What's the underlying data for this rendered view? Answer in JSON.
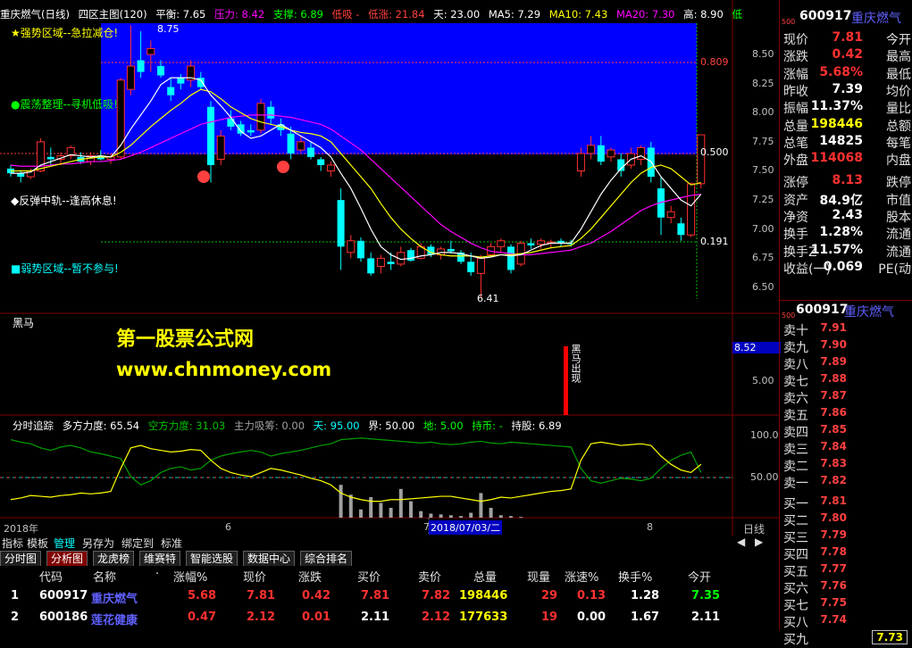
{
  "colors": {
    "up": "#ff3030",
    "down": "#00ffff",
    "yellow": "#ffff00",
    "blue_zone": "#0000ff",
    "magenta": "#ff00ff",
    "white": "#ffffff",
    "green": "#00c000",
    "grey": "#c0c0c0"
  },
  "main_header": {
    "title": "重庆燃气(日线)",
    "zone": "四区主图(120)",
    "pingheng": "平衡: 7.65",
    "yali": "压力: 8.42",
    "zhicheng": "支撑: 6.89",
    "dixi": "低吸 -",
    "dizhang": "低涨: 21.84",
    "tian": "天: 23.00",
    "ma5": "MA5: 7.29",
    "ma10": "MA10: 7.43",
    "ma20": "MA20: 7.30",
    "gao": "高: 8.90",
    "di": "低"
  },
  "zones": {
    "z1": "★强势区域--急拉减仓!",
    "z2": "●震荡整理--寻机低吸!",
    "z3": "◆反弹中轨--逢高休息!",
    "z4": "■弱势区域--暂不参与!"
  },
  "price_annots": {
    "high": "8.75",
    "low": "6.41",
    "r1": "0.809",
    "r2": "0.500",
    "r3": "0.191"
  },
  "price_axis": [
    "8.50",
    "8.25",
    "8.00",
    "7.75",
    "7.50",
    "7.25",
    "7.00",
    "6.75",
    "6.50"
  ],
  "heima": {
    "title": "黑马",
    "label": "黑马出现",
    "axis_val": "8.52",
    "axis2": "5.00"
  },
  "watermark": {
    "line1": "第一股票公式网",
    "line2": "www.chnmoney.com"
  },
  "osc": {
    "title": "分时追踪",
    "duofang": "多方力度: 65.54",
    "kongfang": "空方力度: 31.03",
    "zhuli": "主力吸筹: 0.00",
    "tian": "天: 95.00",
    "jie": "界: 50.00",
    "di": "地: 5.00",
    "chibi": "持币: -",
    "chigu": "持股: 6.89",
    "axis": [
      "100.0",
      "50.00"
    ]
  },
  "date_axis": {
    "d1": "2018年",
    "d2": "6",
    "d3": "7",
    "d4": "8",
    "cursor": "2018/07/03/二",
    "period": "日线"
  },
  "toolbar": [
    "指标",
    "模板",
    "管理",
    "另存为",
    "绑定到",
    "标准"
  ],
  "tabs": [
    "分时图",
    "分析图",
    "龙虎榜",
    "维赛特",
    "智能选股",
    "数据中心",
    "综合排名"
  ],
  "table": {
    "headers": [
      "代码",
      "名称",
      "·",
      "涨幅%",
      "现价",
      "涨跌",
      "买价",
      "卖价",
      "总量",
      "现量",
      "涨速%",
      "换手%",
      "今开"
    ],
    "rows": [
      {
        "idx": "1",
        "code": "600917",
        "name": "重庆燃气",
        "chg_pct": "5.68",
        "price": "7.81",
        "chg": "0.42",
        "bid": "7.81",
        "ask": "7.82",
        "vol": "198446",
        "cur": "29",
        "speed": "0.13",
        "turn": "1.28",
        "open": "7.35"
      },
      {
        "idx": "2",
        "code": "600186",
        "name": "莲花健康",
        "chg_pct": "0.47",
        "price": "2.12",
        "chg": "0.01",
        "bid": "2.11",
        "ask": "2.12",
        "vol": "177633",
        "cur": "19",
        "speed": "0.00",
        "turn": "1.67",
        "open": "2.11"
      }
    ]
  },
  "quote": {
    "code": "600917",
    "name": "重庆燃气",
    "tag": "500",
    "rows": [
      {
        "l": "现价",
        "v": "7.81",
        "r": "今开",
        "c": "up"
      },
      {
        "l": "涨跌",
        "v": "0.42",
        "r": "最高",
        "c": "up"
      },
      {
        "l": "涨幅",
        "v": "5.68%",
        "r": "最低",
        "c": "up"
      },
      {
        "l": "昨收",
        "v": "7.39",
        "r": "均价",
        "c": "white"
      },
      {
        "l": "振幅",
        "v": "11.37%",
        "r": "量比",
        "c": "white"
      },
      {
        "l": "总量",
        "v": "198446",
        "r": "总额",
        "c": "yellow"
      },
      {
        "l": "总笔",
        "v": "14825",
        "r": "每笔",
        "c": "white"
      },
      {
        "l": "外盘",
        "v": "114068",
        "r": "内盘",
        "c": "up"
      },
      {
        "l": "涨停",
        "v": "8.13",
        "r": "跌停",
        "c": "up"
      },
      {
        "l": "资产",
        "v": "84.9亿",
        "r": "市值",
        "c": "white"
      },
      {
        "l": "净资",
        "v": "2.43",
        "r": "股本",
        "c": "white"
      },
      {
        "l": "换手",
        "v": "1.28%",
        "r": "流通",
        "c": "white"
      },
      {
        "l": "换手Z",
        "v": "11.57%",
        "r": "流通",
        "c": "white"
      },
      {
        "l": "收益(一)",
        "v": "0.069",
        "r": "PE(动",
        "c": "white"
      }
    ]
  },
  "orderbook": {
    "code": "600917",
    "name": "重庆燃气",
    "tag": "500",
    "sells": [
      {
        "l": "卖十",
        "v": "7.91"
      },
      {
        "l": "卖九",
        "v": "7.90"
      },
      {
        "l": "卖八",
        "v": "7.89"
      },
      {
        "l": "卖七",
        "v": "7.88"
      },
      {
        "l": "卖六",
        "v": "7.87"
      },
      {
        "l": "卖五",
        "v": "7.86"
      },
      {
        "l": "卖四",
        "v": "7.85"
      },
      {
        "l": "卖三",
        "v": "7.84"
      },
      {
        "l": "卖二",
        "v": "7.83"
      },
      {
        "l": "卖一",
        "v": "7.82"
      }
    ],
    "buys": [
      {
        "l": "买一",
        "v": "7.81"
      },
      {
        "l": "买二",
        "v": "7.80"
      },
      {
        "l": "买三",
        "v": "7.79"
      },
      {
        "l": "买四",
        "v": "7.78"
      },
      {
        "l": "买五",
        "v": "7.77"
      },
      {
        "l": "买六",
        "v": "7.76"
      },
      {
        "l": "买七",
        "v": "7.75"
      },
      {
        "l": "买八",
        "v": "7.74"
      },
      {
        "l": "买九",
        "v": "7.73"
      }
    ]
  },
  "chart_data": {
    "type": "candlestick",
    "candles": [
      [
        7.52,
        7.55,
        7.45,
        7.48
      ],
      [
        7.48,
        7.5,
        7.4,
        7.45
      ],
      [
        7.45,
        7.52,
        7.43,
        7.5
      ],
      [
        7.5,
        7.78,
        7.49,
        7.75
      ],
      [
        7.62,
        7.7,
        7.55,
        7.6
      ],
      [
        7.6,
        7.66,
        7.55,
        7.63
      ],
      [
        7.63,
        7.72,
        7.6,
        7.7
      ],
      [
        7.62,
        7.66,
        7.56,
        7.58
      ],
      [
        7.58,
        7.66,
        7.55,
        7.63
      ],
      [
        7.63,
        7.68,
        7.59,
        7.6
      ],
      [
        7.6,
        7.65,
        7.56,
        7.62
      ],
      [
        7.62,
        8.3,
        7.6,
        8.28
      ],
      [
        8.2,
        8.75,
        8.15,
        8.4
      ],
      [
        8.45,
        8.7,
        8.3,
        8.35
      ],
      [
        8.5,
        8.62,
        8.35,
        8.55
      ],
      [
        8.4,
        8.45,
        8.3,
        8.32
      ],
      [
        8.22,
        8.3,
        8.1,
        8.15
      ],
      [
        8.3,
        8.33,
        8.2,
        8.25
      ],
      [
        8.28,
        8.45,
        8.22,
        8.4
      ],
      [
        8.3,
        8.35,
        8.2,
        8.22
      ],
      [
        8.05,
        8.1,
        7.4,
        7.55
      ],
      [
        7.6,
        7.85,
        7.55,
        7.8
      ],
      [
        7.95,
        8.02,
        7.85,
        7.88
      ],
      [
        7.9,
        7.93,
        7.8,
        7.82
      ],
      [
        7.85,
        7.9,
        7.8,
        7.83
      ],
      [
        7.85,
        8.12,
        7.82,
        8.08
      ],
      [
        8.05,
        8.1,
        7.9,
        7.95
      ],
      [
        7.9,
        7.95,
        7.8,
        7.85
      ],
      [
        7.82,
        7.88,
        7.6,
        7.65
      ],
      [
        7.68,
        7.8,
        7.66,
        7.75
      ],
      [
        7.7,
        7.75,
        7.6,
        7.62
      ],
      [
        7.6,
        7.62,
        7.5,
        7.55
      ],
      [
        7.5,
        7.58,
        7.45,
        7.55
      ],
      [
        7.25,
        7.35,
        6.65,
        6.85
      ],
      [
        6.8,
        6.95,
        6.75,
        6.9
      ],
      [
        6.9,
        6.93,
        6.72,
        6.75
      ],
      [
        6.75,
        6.8,
        6.6,
        6.62
      ],
      [
        6.68,
        6.78,
        6.62,
        6.75
      ],
      [
        6.72,
        6.8,
        6.65,
        6.7
      ],
      [
        6.7,
        6.85,
        6.68,
        6.8
      ],
      [
        6.82,
        6.84,
        6.72,
        6.73
      ],
      [
        6.75,
        6.88,
        6.74,
        6.85
      ],
      [
        6.85,
        6.87,
        6.76,
        6.78
      ],
      [
        6.78,
        6.85,
        6.74,
        6.83
      ],
      [
        6.83,
        6.9,
        6.79,
        6.81
      ],
      [
        6.8,
        6.82,
        6.7,
        6.72
      ],
      [
        6.72,
        6.8,
        6.6,
        6.63
      ],
      [
        6.62,
        6.78,
        6.41,
        6.75
      ],
      [
        6.78,
        6.88,
        6.76,
        6.85
      ],
      [
        6.85,
        6.92,
        6.8,
        6.9
      ],
      [
        6.85,
        6.87,
        6.62,
        6.65
      ],
      [
        6.7,
        6.9,
        6.68,
        6.88
      ],
      [
        6.88,
        6.92,
        6.83,
        6.86
      ],
      [
        6.87,
        6.92,
        6.83,
        6.9
      ],
      [
        6.88,
        6.91,
        6.84,
        6.89
      ],
      [
        6.9,
        6.92,
        6.85,
        6.88
      ],
      [
        6.88,
        6.91,
        6.85,
        6.87
      ],
      [
        7.5,
        7.7,
        7.45,
        7.65
      ],
      [
        7.65,
        7.8,
        7.6,
        7.72
      ],
      [
        7.72,
        7.8,
        7.55,
        7.58
      ],
      [
        7.62,
        7.7,
        7.58,
        7.68
      ],
      [
        7.6,
        7.65,
        7.45,
        7.5
      ],
      [
        7.55,
        7.7,
        7.52,
        7.65
      ],
      [
        7.6,
        7.72,
        7.55,
        7.7
      ],
      [
        7.7,
        7.75,
        7.4,
        7.45
      ],
      [
        7.35,
        7.45,
        6.95,
        7.1
      ],
      [
        7.1,
        7.2,
        7.05,
        7.15
      ],
      [
        7.05,
        7.1,
        6.9,
        6.95
      ],
      [
        6.95,
        7.4,
        6.93,
        7.39
      ],
      [
        7.39,
        7.81,
        7.35,
        7.81
      ]
    ],
    "ma_white": [
      7.48,
      7.48,
      7.49,
      7.55,
      7.58,
      7.61,
      7.64,
      7.63,
      7.62,
      7.63,
      7.62,
      7.72,
      7.86,
      7.98,
      8.1,
      8.24,
      8.3,
      8.3,
      8.3,
      8.28,
      8.15,
      8.06,
      7.96,
      7.84,
      7.78,
      7.8,
      7.85,
      7.9,
      7.85,
      7.8,
      7.75,
      7.7,
      7.62,
      7.48,
      7.35,
      7.18,
      7.0,
      6.85,
      6.78,
      6.74,
      6.75,
      6.77,
      6.78,
      6.8,
      6.8,
      6.79,
      6.77,
      6.75,
      6.76,
      6.78,
      6.77,
      6.78,
      6.82,
      6.86,
      6.88,
      6.88,
      6.88,
      7.0,
      7.15,
      7.3,
      7.42,
      7.52,
      7.6,
      7.63,
      7.58,
      7.45,
      7.35,
      7.25,
      7.2,
      7.3
    ],
    "ma_yellow": [
      7.5,
      7.5,
      7.5,
      7.52,
      7.54,
      7.56,
      7.58,
      7.6,
      7.61,
      7.62,
      7.62,
      7.66,
      7.72,
      7.8,
      7.88,
      7.95,
      8.02,
      8.08,
      8.15,
      8.2,
      8.18,
      8.12,
      8.05,
      8.0,
      7.95,
      7.92,
      7.9,
      7.88,
      7.85,
      7.83,
      7.82,
      7.8,
      7.75,
      7.65,
      7.55,
      7.45,
      7.35,
      7.22,
      7.1,
      7.0,
      6.92,
      6.85,
      6.8,
      6.78,
      6.77,
      6.77,
      6.77,
      6.76,
      6.77,
      6.78,
      6.78,
      6.79,
      6.8,
      6.82,
      6.84,
      6.85,
      6.86,
      6.92,
      7.0,
      7.1,
      7.2,
      7.3,
      7.4,
      7.48,
      7.53,
      7.55,
      7.52,
      7.45,
      7.38,
      7.4
    ],
    "ma_magenta": [
      7.55,
      7.54,
      7.54,
      7.54,
      7.55,
      7.56,
      7.56,
      7.57,
      7.58,
      7.58,
      7.59,
      7.6,
      7.63,
      7.66,
      7.7,
      7.74,
      7.78,
      7.82,
      7.86,
      7.9,
      7.92,
      7.94,
      7.96,
      7.97,
      7.98,
      7.98,
      7.98,
      7.97,
      7.96,
      7.94,
      7.92,
      7.9,
      7.86,
      7.8,
      7.74,
      7.68,
      7.6,
      7.52,
      7.44,
      7.36,
      7.28,
      7.2,
      7.12,
      7.04,
      6.98,
      6.93,
      6.88,
      6.84,
      6.81,
      6.8,
      6.79,
      6.78,
      6.78,
      6.79,
      6.8,
      6.81,
      6.82,
      6.85,
      6.88,
      6.93,
      6.98,
      7.04,
      7.1,
      7.16,
      7.2,
      7.23,
      7.25,
      7.27,
      7.29,
      7.3
    ],
    "osc_yellow": [
      22,
      24,
      27,
      26,
      25,
      27,
      28,
      30,
      29,
      30,
      32,
      60,
      85,
      88,
      84,
      82,
      80,
      81,
      83,
      82,
      70,
      60,
      55,
      52,
      50,
      55,
      60,
      58,
      55,
      52,
      48,
      45,
      40,
      30,
      25,
      22,
      20,
      20,
      22,
      22,
      23,
      24,
      25,
      26,
      26,
      24,
      22,
      20,
      22,
      25,
      24,
      26,
      28,
      30,
      32,
      33,
      35,
      70,
      90,
      92,
      90,
      88,
      89,
      90,
      88,
      75,
      65,
      58,
      55,
      65
    ],
    "osc_green": [
      95,
      92,
      90,
      85,
      82,
      86,
      88,
      85,
      80,
      78,
      75,
      72,
      50,
      40,
      45,
      55,
      60,
      62,
      58,
      60,
      70,
      75,
      78,
      80,
      82,
      80,
      75,
      78,
      80,
      82,
      85,
      88,
      90,
      95,
      96,
      97,
      96,
      95,
      94,
      93,
      92,
      91,
      92,
      90,
      89,
      90,
      92,
      93,
      91,
      90,
      92,
      91,
      90,
      89,
      88,
      87,
      86,
      60,
      45,
      42,
      45,
      48,
      47,
      45,
      48,
      60,
      70,
      76,
      80,
      55
    ],
    "osc_bars": [
      0,
      0,
      0,
      0,
      0,
      0,
      0,
      0,
      0,
      0,
      0,
      0,
      0,
      0,
      0,
      0,
      0,
      0,
      0,
      0,
      0,
      0,
      0,
      0,
      0,
      0,
      0,
      0,
      0,
      0,
      0,
      0,
      0,
      40,
      28,
      10,
      25,
      18,
      12,
      35,
      20,
      8,
      5,
      4,
      3,
      2,
      6,
      30,
      12,
      3,
      2,
      1,
      0,
      0,
      0,
      0,
      0,
      0,
      0,
      0,
      0,
      0,
      0,
      0,
      0,
      0,
      0,
      0,
      0,
      0
    ],
    "osc_ylim": [
      0,
      100
    ]
  }
}
